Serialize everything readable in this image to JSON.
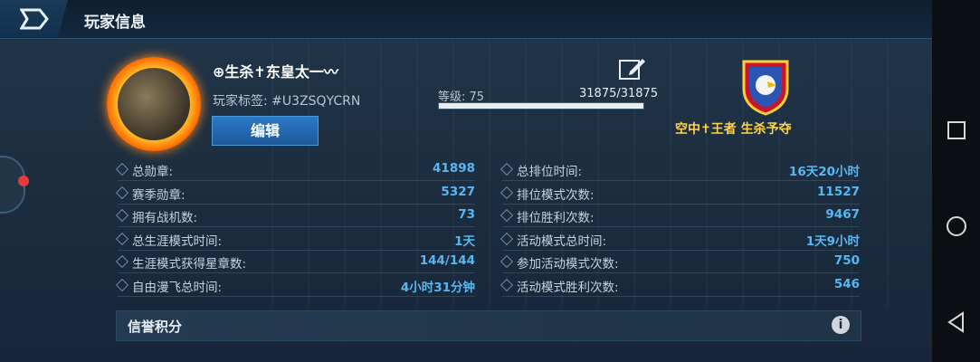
{
  "header": {
    "title": "玩家信息"
  },
  "player": {
    "name": "⊕生杀✝东皇太一〰",
    "tag_label": "玩家标签:",
    "tag_value": "#U3ZSQYCRN",
    "edit_label": "编辑",
    "level_label": "等级: 75",
    "xp_text": "31875/31875",
    "xp_fraction": 1.0
  },
  "badge": {
    "title": "空中✝王者 生杀予夺"
  },
  "stats_left": [
    {
      "label": "总勋章:",
      "value": "41898"
    },
    {
      "label": "赛季勋章:",
      "value": "5327"
    },
    {
      "label": "拥有战机数:",
      "value": "73"
    },
    {
      "label": "总生涯模式时间:",
      "value": "1天"
    },
    {
      "label": "生涯模式获得星章数:",
      "value": "144/144"
    },
    {
      "label": "自由漫飞总时间:",
      "value": "4小时31分钟"
    }
  ],
  "stats_right": [
    {
      "label": "总排位时间:",
      "value": "16天20小时"
    },
    {
      "label": "排位模式次数:",
      "value": "11527"
    },
    {
      "label": "排位胜利次数:",
      "value": "9467"
    },
    {
      "label": "活动模式总时间:",
      "value": "1天9小时"
    },
    {
      "label": "参加活动模式次数:",
      "value": "750"
    },
    {
      "label": "活动模式胜利次数:",
      "value": "546"
    }
  ],
  "credit": {
    "label": "信誉积分",
    "info": "i"
  },
  "colors": {
    "accent": "#57b7f2",
    "gold": "#ffd24a",
    "button": "#2c79c4"
  }
}
